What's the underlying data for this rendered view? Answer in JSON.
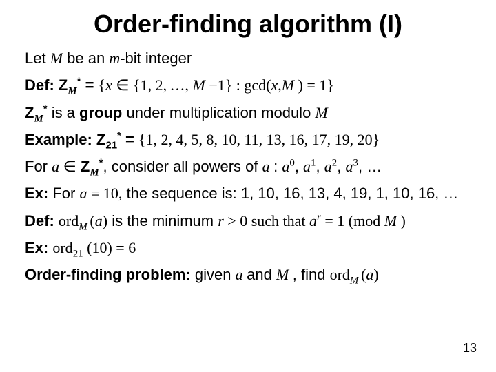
{
  "title": "Order-finding algorithm (I)",
  "lines": {
    "l1_a": "Let ",
    "l1_M": "M",
    "l1_b": " be an ",
    "l1_m": "m",
    "l1_c": "-bit integer",
    "l2_a": "Def: Z",
    "l2_sub1": "M",
    "l2_star": "*",
    "l2_eq": " = ",
    "l2_lb": "{",
    "l2_x": "x ",
    "l2_in": "∈",
    "l2_set": " {1, 2, …, ",
    "l2_M": "M ",
    "l2_minus": "−1} : gcd(",
    "l2_x2": "x",
    "l2_comma": ",",
    "l2_M2": "M ",
    "l2_end": ") = 1",
    "l2_rb": "}",
    "l3_a": "Z",
    "l3_sub": "M",
    "l3_star": "*",
    "l3_b": " is a ",
    "l3_bold": "group",
    "l3_c": " under multiplication modulo ",
    "l3_M": "M",
    "l4_a": "Example: Z",
    "l4_sub": "21",
    "l4_star": "*",
    "l4_eq": " = ",
    "l4_lb": "{",
    "l4_set": "1, 2, 4, 5, 8, 10, 11, 13, 16, 17, 19, 20",
    "l4_rb": "}",
    "l5_a": "For ",
    "l5_ain": "a ",
    "l5_in": "∈",
    "l5_b": " Z",
    "l5_sub": "M",
    "l5_star": "*",
    "l5_c": ", consider all powers of ",
    "l5_a2": "a ",
    "l5_colon": ": ",
    "l5_a3": "a",
    "l5_p0": "0",
    "l5_s1": ", ",
    "l5_a4": "a",
    "l5_p1": "1",
    "l5_s2": ", ",
    "l5_a5": "a",
    "l5_p2": "2",
    "l5_s3": ", ",
    "l5_a6": "a",
    "l5_p3": "3",
    "l5_dots": ", …",
    "l6_a": "Ex:",
    "l6_b": " For ",
    "l6_avar": "a ",
    "l6_eq": "= 10,",
    "l6_seq": " the sequence is: 1, 10, 16, 13, 4, 19, 1, 10, 16, …",
    "l7_a": "Def: ",
    "l7_ord": "ord",
    "l7_sub": "M ",
    "l7_par": "(",
    "l7_avar": "a",
    "l7_cp": ")",
    "l7_b": " is the minimum ",
    "l7_r": "r ",
    "l7_gt": "> 0 such that ",
    "l7_ar": "a",
    "l7_rp": "r",
    "l7_eq": " = 1 (mod ",
    "l7_M": "M ",
    "l7_end": ")",
    "l8_a": "Ex: ",
    "l8_ord": "ord",
    "l8_sub": "21",
    "l8_par": " (10) = 6",
    "l9_a": "Order-finding problem:",
    "l9_b": " given ",
    "l9_avar": "a ",
    "l9_and": "and ",
    "l9_M": "M ",
    "l9_c": ", find ",
    "l9_ord": "ord",
    "l9_sub": "M ",
    "l9_par": "(",
    "l9_avar2": "a",
    "l9_cp": ")"
  },
  "page_number": "13"
}
